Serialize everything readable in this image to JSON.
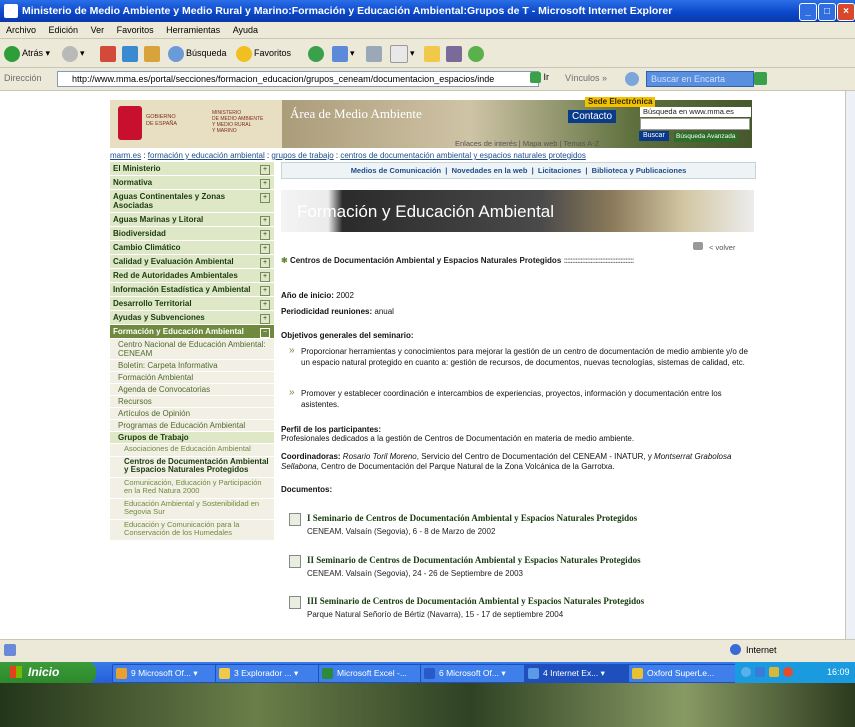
{
  "window": {
    "title": "Ministerio de Medio Ambiente y Medio Rural y Marino:Formación y Educación Ambiental:Grupos de T - Microsoft Internet Explorer"
  },
  "menu": [
    "Archivo",
    "Edición",
    "Ver",
    "Favoritos",
    "Herramientas",
    "Ayuda"
  ],
  "toolbar": {
    "back": "Atrás",
    "search": "Búsqueda",
    "favorites": "Favoritos"
  },
  "address": {
    "label": "Dirección",
    "url": "http://www.mma.es/portal/secciones/formacion_educacion/grupos_ceneam/documentacion_espacios/inde",
    "go": "Ir",
    "links": "Vínculos",
    "encarta_placeholder": "Buscar en Encarta"
  },
  "header": {
    "gob1": "GOBIERNO",
    "gob2": "DE ESPAÑA",
    "min1": "MINISTERIO",
    "min2": "DE MEDIO AMBIENTE",
    "min3": "Y MEDIO RURAL",
    "min4": "Y MARINO",
    "area": "Área de Medio Ambiente",
    "sede": "Sede Electrónica",
    "contacto": "Contacto",
    "busqueda_label": "Búsqueda en www.mma.es",
    "buscar": "Buscar",
    "busqueda_avanzada": "Búsqueda Avanzada",
    "enlaces": "Enlaces de interés | Mapa web | Temas A-Z"
  },
  "breadcrumb": {
    "b1": "marm.es",
    "b2": "formación y educación ambiental",
    "b3": "grupos de trabajo",
    "b4": "centros de documentación ambiental y espacios naturales protegidos"
  },
  "nav": {
    "items": [
      "El Ministerio",
      "Normativa",
      "Aguas Continentales y Zonas Asociadas",
      "Aguas Marinas y Litoral",
      "Biodiversidad",
      "Cambio Climático",
      "Calidad y Evaluación Ambiental",
      "Red de Autoridades Ambientales",
      "Información Estadística y Ambiental",
      "Desarrollo Territorial",
      "Ayudas y Subvenciones",
      "Formación y Educación Ambiental"
    ],
    "subitems": [
      "Centro Nacional de Educación Ambiental: CENEAM",
      "Boletín: Carpeta Informativa",
      "Formación Ambiental",
      "Agenda de Convocatorias",
      "Recursos",
      "Artículos de Opinión",
      "Programas de Educación Ambiental",
      "Grupos de Trabajo"
    ],
    "subsubitems": [
      "Asociaciones de Educación Ambiental",
      "Centros de Documentación Ambiental y Espacios Naturales Protegidos",
      "Comunicación, Educación y Participación en la Red Natura 2000",
      "Educación Ambiental y Sostenibilidad en Segovia Sur",
      "Educación y Comunicación para la Conservación de los Humedales"
    ]
  },
  "topnav": [
    "Medios de Comunicación",
    "Novedades en la web",
    "Licitaciones",
    "Biblioteca y Publicaciones"
  ],
  "banner": "Formación y Educación Ambiental",
  "volver": "< volver",
  "section_title": "Centros de Documentación Ambiental y Espacios Naturales Protegidos",
  "section_dots": "::::::::::::::::::::::::::::::::::::::::::",
  "content": {
    "anio_label": "Año de inicio:",
    "anio": "2002",
    "period_label": "Periodicidad reuniones:",
    "period": "anual",
    "obj_label": "Objetivos generales del seminario:",
    "obj1": "Proporcionar herramientas y conocimientos para mejorar la gestión de un centro de documentación de medio ambiente y/o de un espacio natural protegido en cuanto a: gestión de recursos, de documentos, nuevas tecnologías, sistemas de calidad, etc.",
    "obj2": "Promover y establecer coordinación e intercambios de experiencias, proyectos, información y documentación entre los asistentes.",
    "perfil_label": "Perfil de los participantes:",
    "perfil": "Profesionales dedicados a la gestión de Centros de Documentación en materia de medio ambiente.",
    "coord_label": "Coordinadoras:",
    "coord_name1": "Rosario Toril Moreno",
    "coord_mid": ", Servicio del Centro de Documentación del CENEAM - INATUR, y ",
    "coord_name2": "Montserrat Grabolosa Sellabona",
    "coord_end": ", Centro de Documentación del Parque Natural de la Zona Volcánica de la Garrotxa.",
    "docs_label": "Documentos:"
  },
  "documents": [
    {
      "title": "I Seminario de Centros de Documentación Ambiental y Espacios Naturales Protegidos",
      "desc": "CENEAM. Valsaín (Segovia), 6 - 8 de Marzo de 2002"
    },
    {
      "title": "II Seminario de Centros de Documentación Ambiental y Espacios Naturales Protegidos",
      "desc": "CENEAM. Valsaín (Segovia), 24 - 26 de Septiembre de 2003"
    },
    {
      "title": "III Seminario de Centros de Documentación Ambiental y Espacios Naturales Protegidos",
      "desc": "Parque Natural Señorío de Bértiz (Navarra), 15 - 17 de septiembre 2004"
    }
  ],
  "status": {
    "zone": "Internet"
  },
  "taskbar": {
    "start": "Inicio",
    "tasks": [
      "9 Microsoft Of...",
      "3 Explorador ...",
      "Microsoft Excel -...",
      "6 Microsoft Of...",
      "4 Internet Ex...",
      "Oxford SuperLe..."
    ],
    "clock": "16:09"
  }
}
